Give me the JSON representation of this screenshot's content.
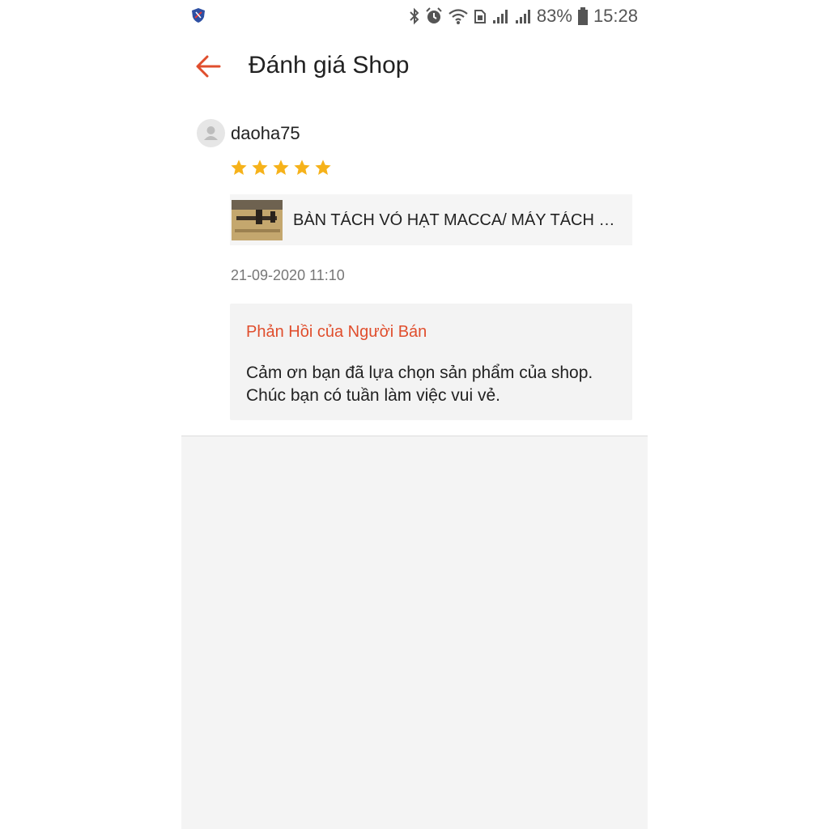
{
  "status_bar": {
    "battery": "83%",
    "time": "15:28",
    "icons": [
      "shield-icon",
      "bluetooth-icon",
      "alarm-icon",
      "wifi-icon",
      "sim-icon",
      "signal-icon",
      "signal-icon",
      "battery-icon"
    ]
  },
  "header": {
    "title": "Đánh giá Shop",
    "back_icon": "arrow-left-icon",
    "accent_color": "#e04e2d"
  },
  "review": {
    "username": "daoha75",
    "rating": 5,
    "rating_max": 5,
    "star_color": "#f6b21a",
    "product_name": "BÀN TÁCH VỎ HẠT MACCA/ MÁY TÁCH VỎ HẠT MACCA",
    "time": "21-09-2020 11:10"
  },
  "seller_reply": {
    "title": "Phản Hồi của Người Bán",
    "text_line1": "Cảm ơn bạn đã lựa chọn sản phẩm của shop.",
    "text_line2": "Chúc bạn có tuần làm việc vui vẻ."
  }
}
